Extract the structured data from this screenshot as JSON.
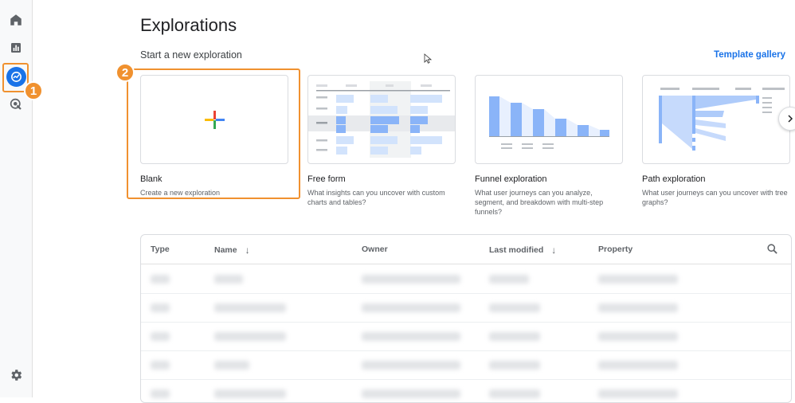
{
  "page": {
    "title": "Explorations",
    "section_title": "Start a new exploration",
    "template_gallery_link": "Template gallery"
  },
  "sidebar": {
    "items": [
      {
        "icon": "home-icon"
      },
      {
        "icon": "reports-icon"
      },
      {
        "icon": "explore-icon",
        "active": true
      },
      {
        "icon": "advertising-icon"
      },
      {
        "icon": "settings-icon"
      }
    ]
  },
  "callouts": {
    "step1": "1",
    "step2": "2",
    "color": "#f0912f"
  },
  "templates": [
    {
      "title": "Blank",
      "description": "Create a new exploration"
    },
    {
      "title": "Free form",
      "description": "What insights can you uncover with custom charts and tables?"
    },
    {
      "title": "Funnel exploration",
      "description": "What user journeys can you analyze, segment, and breakdown with multi-step funnels?"
    },
    {
      "title": "Path exploration",
      "description": "What user journeys can you uncover with tree graphs?"
    }
  ],
  "table": {
    "columns": {
      "type": "Type",
      "name": "Name",
      "owner": "Owner",
      "last_modified": "Last modified",
      "property": "Property"
    },
    "rows_blurred": 5
  },
  "colors": {
    "accent": "#1a73e8",
    "chart_blue": "#8ab4f8",
    "chart_light": "#d2e3fc"
  }
}
